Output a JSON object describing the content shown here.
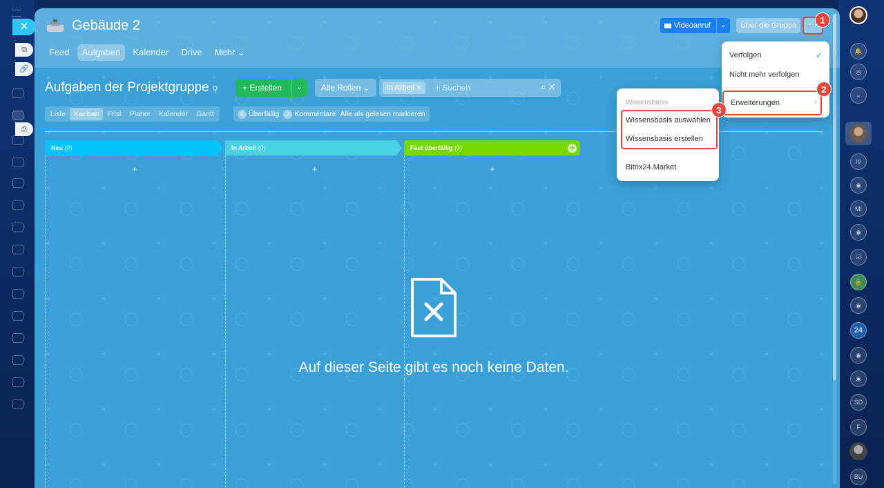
{
  "group": {
    "title": "Gebäude 2"
  },
  "top_tabs": [
    {
      "label": "Feed",
      "active": false
    },
    {
      "label": "Aufgaben",
      "active": true
    },
    {
      "label": "Kalender",
      "active": false
    },
    {
      "label": "Drive",
      "active": false
    },
    {
      "label": "Mehr ⌄",
      "active": false
    }
  ],
  "header_buttons": {
    "video": "Videoanruf",
    "about": "Über die Gruppe",
    "more": "···"
  },
  "page": {
    "title": "Aufgaben der Projektgruppe"
  },
  "toolbar": {
    "create": "+ Erstellen",
    "roles": "Alle Rollen ⌄",
    "filter_chip": "In Arbeit",
    "search_placeholder": "+ Suchen"
  },
  "view_tabs": [
    {
      "label": "Liste",
      "active": false
    },
    {
      "label": "Kanban",
      "active": true
    },
    {
      "label": "Frist",
      "active": false
    },
    {
      "label": "Planer",
      "active": false
    },
    {
      "label": "Kalender",
      "active": false
    },
    {
      "label": "Gantt",
      "active": false
    }
  ],
  "counters": {
    "overdue_count": "0",
    "overdue_label": "Überfällig",
    "comments_count": "0",
    "comments_label": "Kommentare",
    "mark_read": "Alle als gelesen markieren"
  },
  "columns": [
    {
      "name": "Neu",
      "count": "(0)",
      "color": "#00c4fb"
    },
    {
      "name": "In Arbeit",
      "count": "(0)",
      "color": "#47d1e2"
    },
    {
      "name": "Fast überfällig",
      "count": "(0)",
      "color": "#75d900"
    }
  ],
  "empty_state": {
    "message": "Auf dieser Seite gibt es noch keine Daten."
  },
  "main_menu": {
    "items": [
      "Verfolgen",
      "Nicht mehr verfolgen",
      "Erweiterungen"
    ],
    "checked": "✓"
  },
  "sub_menu": {
    "header": "Wissensbasis",
    "items": [
      "Wissensbasis auswählen",
      "Wissensbasis erstellen",
      "Bitrix24.Market"
    ]
  },
  "badges": [
    "1",
    "2",
    "3"
  ],
  "right_rail_labels": [
    "IV",
    "MI",
    "24",
    "SD",
    "F",
    "BU"
  ],
  "colors": {
    "accent_red": "#e5473f",
    "create_green": "#21b959",
    "video_blue": "#1b7ef2"
  }
}
